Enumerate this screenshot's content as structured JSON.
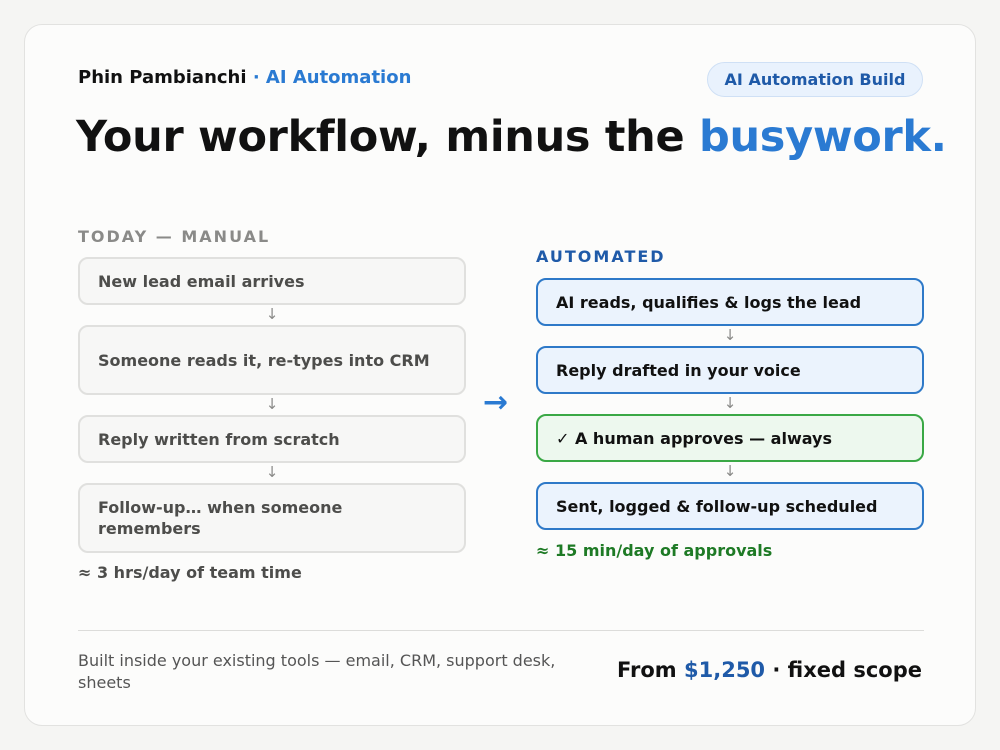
{
  "header": {
    "name": "Phin Pambianchi",
    "tagline": "· AI Automation",
    "badge": "AI Automation Build"
  },
  "headline": {
    "lead": "Your workflow, minus the ",
    "accent": "busywork."
  },
  "manual": {
    "label": "TODAY — MANUAL",
    "steps": [
      "New lead email arrives",
      "Someone reads it, re-types into CRM",
      "Reply written from scratch",
      "Follow-up… when someone remembers"
    ],
    "summary": "≈ 3 hrs/day of team time"
  },
  "automated": {
    "label": "AUTOMATED",
    "steps": [
      "AI reads, qualifies & logs the lead",
      "Reply drafted in your voice",
      "✓ A human approves — always",
      "Sent, logged & follow-up scheduled"
    ],
    "summary": "≈ 15 min/day of approvals"
  },
  "footer": {
    "note": "Built inside your existing tools — email, CRM, support desk, sheets",
    "price_prefix": "From ",
    "price_value": "$1,250",
    "price_suffix": " · fixed scope"
  },
  "icons": {
    "down_arrow": "↓",
    "right_arrow": "→"
  },
  "colors": {
    "accent": "#2a7ad2",
    "dark_accent": "#1f5aa8",
    "success": "#3aa845",
    "success_text": "#1e7a25"
  }
}
